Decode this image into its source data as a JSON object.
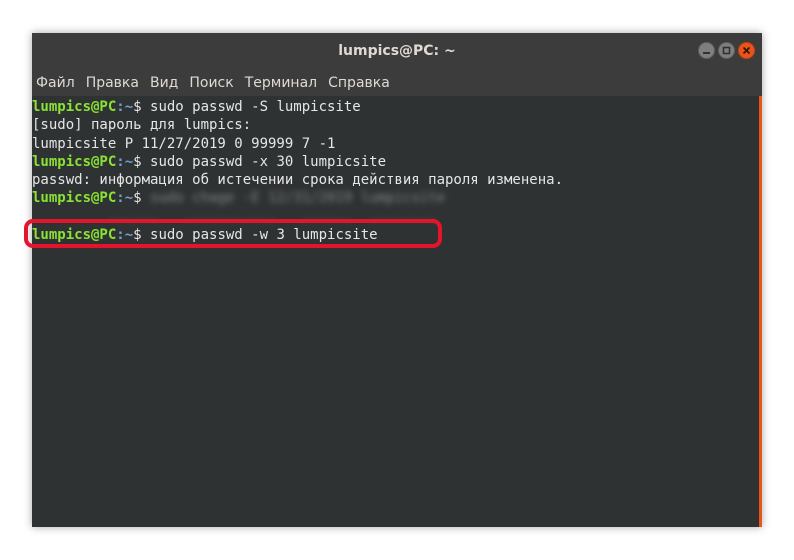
{
  "window": {
    "title": "lumpics@PC: ~"
  },
  "menu": [
    "Файл",
    "Правка",
    "Вид",
    "Поиск",
    "Терминал",
    "Справка"
  ],
  "terminal": {
    "lines": [
      {
        "type": "prompt",
        "user": "lumpics@PC",
        "path": ":~",
        "cmd": "$ sudo passwd -S lumpicsite"
      },
      {
        "type": "output",
        "text": "[sudo] пароль для lumpics:"
      },
      {
        "type": "output",
        "text": "lumpicsite P 11/27/2019 0 99999 7 -1"
      },
      {
        "type": "prompt",
        "user": "lumpics@PC",
        "path": ":~",
        "cmd": "$ sudo passwd -x 30 lumpicsite"
      },
      {
        "type": "output",
        "text": "passwd: информация об истечении срока действия пароля изменена."
      },
      {
        "type": "prompt",
        "user": "lumpics@PC",
        "path": ":~",
        "cmd": "$"
      },
      {
        "type": "highlighted-prompt",
        "user": "lumpics@PC",
        "path": ":~",
        "cmd": "$ sudo passwd -w 3 lumpicsite"
      }
    ]
  },
  "colors": {
    "terminal_bg": "#2f3233",
    "prompt_user": "#8ae234",
    "prompt_path": "#729fcf",
    "highlight": "#e3142b",
    "close_button": "#e9541d"
  }
}
